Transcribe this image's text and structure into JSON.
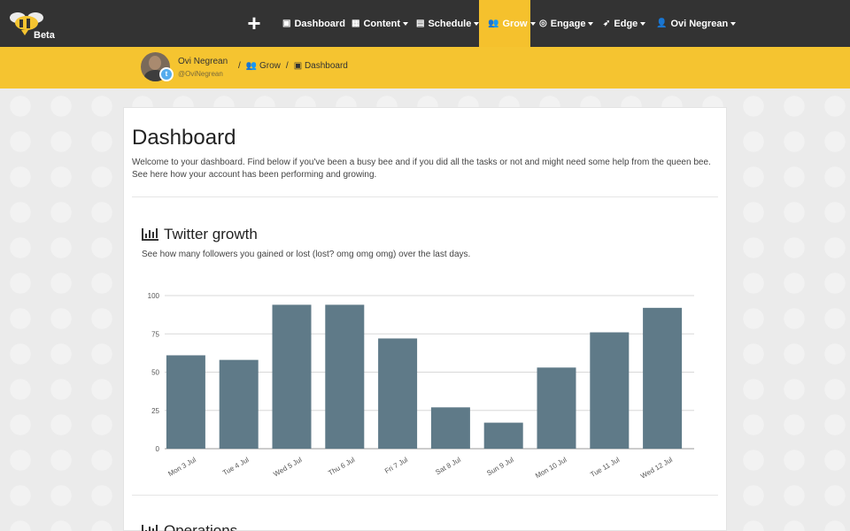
{
  "logo": {
    "badge": "Beta"
  },
  "nav": {
    "items": [
      {
        "label": "Dashboard",
        "icon": "briefcase-icon",
        "glyph": "▣",
        "caret": false,
        "active": false
      },
      {
        "label": "Content",
        "icon": "grid-icon",
        "glyph": "▦",
        "caret": true,
        "active": false
      },
      {
        "label": "Schedule",
        "icon": "calendar-icon",
        "glyph": "▤",
        "caret": true,
        "active": false
      },
      {
        "label": "Grow",
        "icon": "users-icon",
        "glyph": "👥",
        "caret": true,
        "active": true
      },
      {
        "label": "Engage",
        "icon": "target-icon",
        "glyph": "◎",
        "caret": true,
        "active": false
      },
      {
        "label": "Edge",
        "icon": "rocket-icon",
        "glyph": "➶",
        "caret": true,
        "active": false
      },
      {
        "label": "Ovi Negrean",
        "icon": "user-icon",
        "glyph": "👤",
        "caret": true,
        "active": false
      }
    ]
  },
  "profile": {
    "name": "Ovi Negrean",
    "handle": "@OviNegrean"
  },
  "breadcrumb": [
    {
      "label": "Grow",
      "glyph": "👥"
    },
    {
      "label": "Dashboard",
      "glyph": "▣"
    }
  ],
  "page": {
    "title": "Dashboard",
    "intro": "Welcome to your dashboard. Find below if you've been a busy bee and if you did all the tasks or not and might need some help from the queen bee. See here how your account has been performing and growing."
  },
  "twitter_growth": {
    "title": "Twitter growth",
    "description": "See how many followers you gained or lost (lost? omg omg omg) over the last days."
  },
  "operations": {
    "title": "Operations"
  },
  "colors": {
    "bar": "#5f7a88",
    "accent": "#f5c430",
    "nav": "#333333"
  },
  "chart_data": {
    "type": "bar",
    "categories": [
      "Mon 3 Jul",
      "Tue 4 Jul",
      "Wed 5 Jul",
      "Thu 6 Jul",
      "Fri 7 Jul",
      "Sat 8 Jul",
      "Sun 9 Jul",
      "Mon 10 Jul",
      "Tue 11 Jul",
      "Wed 12 Jul"
    ],
    "values": [
      61,
      58,
      94,
      94,
      72,
      27,
      17,
      53,
      76,
      92
    ],
    "yticks": [
      0,
      25,
      50,
      75,
      100
    ],
    "ylim": [
      0,
      100
    ],
    "grid": true
  }
}
